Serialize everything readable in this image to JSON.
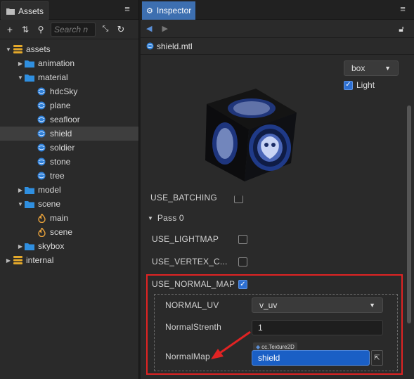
{
  "assets_panel": {
    "tab_label": "Assets",
    "search_placeholder": "Search n",
    "tree": [
      {
        "label": "assets",
        "type": "db",
        "depth": 0,
        "arrow": "down"
      },
      {
        "label": "animation",
        "type": "folder",
        "depth": 1,
        "arrow": "right"
      },
      {
        "label": "material",
        "type": "folder",
        "depth": 1,
        "arrow": "down"
      },
      {
        "label": "hdcSky",
        "type": "material",
        "depth": 2
      },
      {
        "label": "plane",
        "type": "material",
        "depth": 2
      },
      {
        "label": "seafloor",
        "type": "material",
        "depth": 2
      },
      {
        "label": "shield",
        "type": "material",
        "depth": 2,
        "selected": true
      },
      {
        "label": "soldier",
        "type": "material",
        "depth": 2
      },
      {
        "label": "stone",
        "type": "material",
        "depth": 2
      },
      {
        "label": "tree",
        "type": "material",
        "depth": 2
      },
      {
        "label": "model",
        "type": "folder",
        "depth": 1,
        "arrow": "right"
      },
      {
        "label": "scene",
        "type": "folder",
        "depth": 1,
        "arrow": "down"
      },
      {
        "label": "main",
        "type": "scene",
        "depth": 2
      },
      {
        "label": "scene",
        "type": "scene",
        "depth": 2
      },
      {
        "label": "skybox",
        "type": "folder",
        "depth": 1,
        "arrow": "right"
      },
      {
        "label": "internal",
        "type": "db",
        "depth": 0,
        "arrow": "right"
      }
    ]
  },
  "inspector": {
    "tab_label": "Inspector",
    "file_name": "shield.mtl",
    "preview": {
      "shape_select": "box",
      "light_label": "Light",
      "light_checked": true
    },
    "props": {
      "use_batching": "USE_BATCHING",
      "pass_label": "Pass 0",
      "use_lightmap": "USE_LIGHTMAP",
      "use_vertex_color": "USE_VERTEX_C...",
      "use_normal_map": "USE_NORMAL_MAP",
      "normal_uv_label": "NORMAL_UV",
      "normal_uv_value": "v_uv",
      "normal_strength_label": "NormalStrenth",
      "normal_strength_value": "1",
      "normal_map_label": "NormalMap",
      "normal_map_type": "cc.Texture2D",
      "normal_map_value": "shield"
    }
  },
  "colors": {
    "accent": "#3d6fb0",
    "highlight": "#e02323",
    "asset_field": "#1a5fc5"
  }
}
